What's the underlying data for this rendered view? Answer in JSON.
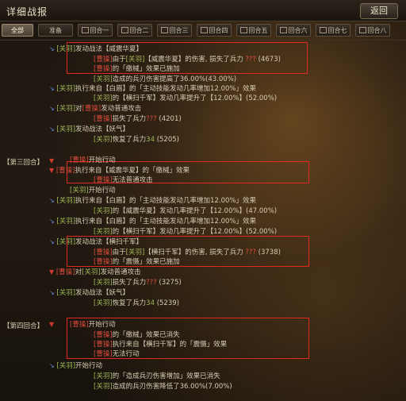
{
  "window": {
    "title": "详细战报",
    "back_label": "返回"
  },
  "tabs": [
    {
      "label": "全部",
      "active": true
    },
    {
      "label": "准备",
      "active": false
    },
    {
      "label": "回合一",
      "active": false
    },
    {
      "label": "回合二",
      "active": false
    },
    {
      "label": "回合三",
      "active": false
    },
    {
      "label": "回合四",
      "active": false
    },
    {
      "label": "回合五",
      "active": false
    },
    {
      "label": "回合六",
      "active": false
    },
    {
      "label": "回合七",
      "active": false
    },
    {
      "label": "回合八",
      "active": false
    }
  ],
  "rounds": {
    "round3": "【第三回合】",
    "round4": "【第四回合】"
  },
  "log": {
    "l1": [
      "[关羽]",
      "发动战法【威震华夏】"
    ],
    "l2": [
      "[曹操]",
      "由于",
      "[关羽]",
      "【威震华夏】的伤害, 损失了兵力",
      "???",
      "(4673)"
    ],
    "l3": [
      "[曹操]",
      "的「缴械」效果已施加"
    ],
    "l4": [
      "[关羽]",
      "造成的兵刃伤害提高了36.00%(43.00%)"
    ],
    "l5": [
      "[关羽]",
      "执行来自【白眉】的「主动技能发动几率增加12.00%」效果"
    ],
    "l6": [
      "[关羽]",
      "的【横扫千军】发动几率提升了【12.00%】(52.00%)"
    ],
    "l7": [
      "[关羽]",
      "对",
      "[曹操]",
      "发动普通攻击"
    ],
    "l8": [
      "[曹操]",
      "损失了兵力",
      "???",
      "(4201)"
    ],
    "l9": [
      "[关羽]",
      "发动战法【妖气】"
    ],
    "l10": [
      "[关羽]",
      "恢复了兵力",
      "34",
      "(5205)"
    ],
    "l11": [
      "[曹操]",
      "开始行动"
    ],
    "l12": [
      "[曹操]",
      "执行来自【威震华夏】的「缴械」效果"
    ],
    "l13": [
      "[曹操]",
      "无法普通攻击"
    ],
    "l14": [
      "[关羽]",
      "开始行动"
    ],
    "l15": [
      "[关羽]",
      "执行来自【白眉】的「主动技能发动几率增加12.00%」效果"
    ],
    "l16": [
      "[关羽]",
      "的【威震华夏】发动几率提升了【12.00%】(47.00%)"
    ],
    "l17": [
      "[关羽]",
      "执行来自【白眉】的「主动技能发动几率增加12.00%」效果"
    ],
    "l18": [
      "[关羽]",
      "的【横扫千军】发动几率提升了【12.00%】(52.00%)"
    ],
    "l19": [
      "[关羽]",
      "发动战法【横扫千军】"
    ],
    "l20": [
      "[曹操]",
      "由于",
      "[关羽]",
      "【横扫千军】的伤害, 损失了兵力",
      "???",
      "(3738)"
    ],
    "l21": [
      "[曹操]",
      "的「震慑」效果已施加"
    ],
    "l22": [
      "[曹操]",
      "对",
      "[关羽]",
      "发动普通攻击"
    ],
    "l23": [
      "[关羽]",
      "损失了兵力",
      "???",
      "(3275)"
    ],
    "l24": [
      "[关羽]",
      "发动战法【妖气】"
    ],
    "l25": [
      "[关羽]",
      "恢复了兵力",
      "34",
      "(5239)"
    ],
    "l26": [
      "[曹操]",
      "开始行动"
    ],
    "l27": [
      "[曹操]",
      "的「缴械」效果已消失"
    ],
    "l28": [
      "[曹操]",
      "执行来自【横扫千军】的「震慑」效果"
    ],
    "l29": [
      "[曹操]",
      "无法行动"
    ],
    "l30": [
      "[关羽]",
      "开始行动"
    ],
    "l31": [
      "[关羽]",
      "的「造成兵刃伤害增加」效果已消失"
    ],
    "l32": [
      "[关羽]",
      "造成的兵刃伤害降低了36.00%(7.00%)"
    ]
  },
  "colors": {
    "ally": "#a0ba58",
    "enemy": "#d94b3a",
    "highlight": "#e0291f",
    "marker": "#5d8fe0"
  }
}
